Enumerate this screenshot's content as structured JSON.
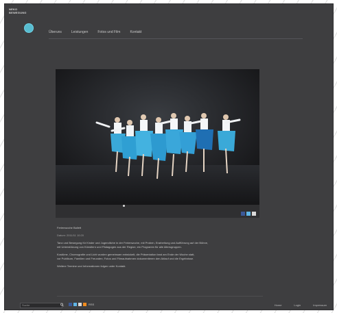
{
  "header": {
    "brand_line1": "NEKO",
    "brand_line2": "BEWEGUNG"
  },
  "nav": {
    "items": [
      "Überuns",
      "Leistungen",
      "Fotos und Film",
      "Kontakt"
    ]
  },
  "gallery": {
    "pages": 1,
    "current_page": 1
  },
  "article": {
    "caption": "Ferienwoche Ballett",
    "meta": "Datum: 2011/11 10:20",
    "paragraphs": [
      "Tanz und Bewegung für Kinder und Jugendliche in der Ferienwoche, mit Proben, Erarbeitung und Aufführung auf der Bühne,",
      "mit Unterstützung von Künstlern und Pädagogen aus der Region; ein Programm für alle Altersgruppen.",
      "Kostüme, Choreografie und Licht wurden gemeinsam entwickelt, die Präsentation fand am Ende der Woche statt,",
      "vor Publikum, Familien und Freunden; Fotos und Filmaufnahmen dokumentieren den Ablauf und die Ergebnisse.",
      "Weitere Termine und Informationen folgen unter Kontakt."
    ]
  },
  "footer": {
    "search_placeholder": "Suche",
    "rss_label": "RSS",
    "links": [
      "Home",
      "Login",
      "Impressum"
    ]
  },
  "colors": {
    "page_bg": "#3e3e40",
    "accent": "#58bcd0",
    "text": "#c8c8c8"
  }
}
